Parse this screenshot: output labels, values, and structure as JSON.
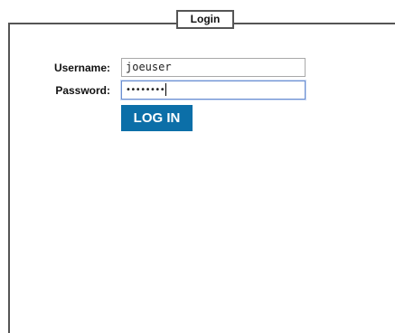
{
  "login_panel": {
    "title": "Login",
    "username_label": "Username:",
    "username_value": "joeuser",
    "password_label": "Password:",
    "password_masked": "••••••••",
    "login_button_label": "LOG IN"
  },
  "colors": {
    "button_background": "#0c6fa8",
    "button_text": "#ffffff",
    "focused_input_border": "#6b8fd1",
    "frame_border": "#555555"
  }
}
